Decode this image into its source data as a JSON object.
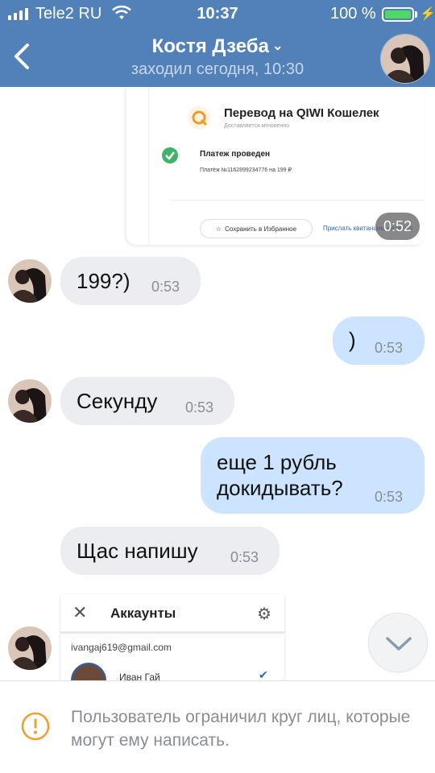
{
  "status_bar": {
    "carrier": "Tele2 RU",
    "time": "10:37",
    "battery_percent": "100 %",
    "battery_level": 1.0,
    "icons": [
      "signal-icon",
      "wifi-icon",
      "battery-icon",
      "charging-icon"
    ]
  },
  "header": {
    "title": "Костя Дзеба",
    "title_chevron": "⌄",
    "subtitle": "заходил сегодня, 10:30",
    "back_icon": "chevron-left-icon",
    "background": "#5181b8"
  },
  "receipt_card": {
    "title": "Перевод на QIWI Кошелек",
    "subtitle": "Доставляется мгновенно",
    "status_title": "Платеж проведен",
    "status_desc": "Платёж №1162899234776 на 199 ₽",
    "save_button": "Сохранить в Избранное",
    "send_receipt_link": "Прислать квитанцию на почту",
    "time": "0:52"
  },
  "messages": [
    {
      "direction": "in",
      "text": "199?)",
      "time": "0:53"
    },
    {
      "direction": "out",
      "text": ")",
      "time": "0:53"
    },
    {
      "direction": "in",
      "text": "Секунду",
      "time": "0:53"
    },
    {
      "direction": "out",
      "text_line1": "еще 1 рубль",
      "text_line2": "докидывать?",
      "time": "0:53"
    },
    {
      "direction": "in",
      "text": "Щас напишу",
      "time": "0:53"
    }
  ],
  "attached_screenshot": {
    "close_icon": "close-icon",
    "title": "Аккаунты",
    "gear_icon": "gear-icon",
    "email": "ivangaj619@gmail.com",
    "name": "Иван Гай"
  },
  "footer": {
    "warning": "Пользователь ограничил круг лиц, которые могут ему написать.",
    "accent_color": "#f0a030"
  },
  "colors": {
    "incoming_bubble": "#ebedf0",
    "outgoing_bubble": "#cce4ff",
    "timestamp": "#8a8e94"
  }
}
